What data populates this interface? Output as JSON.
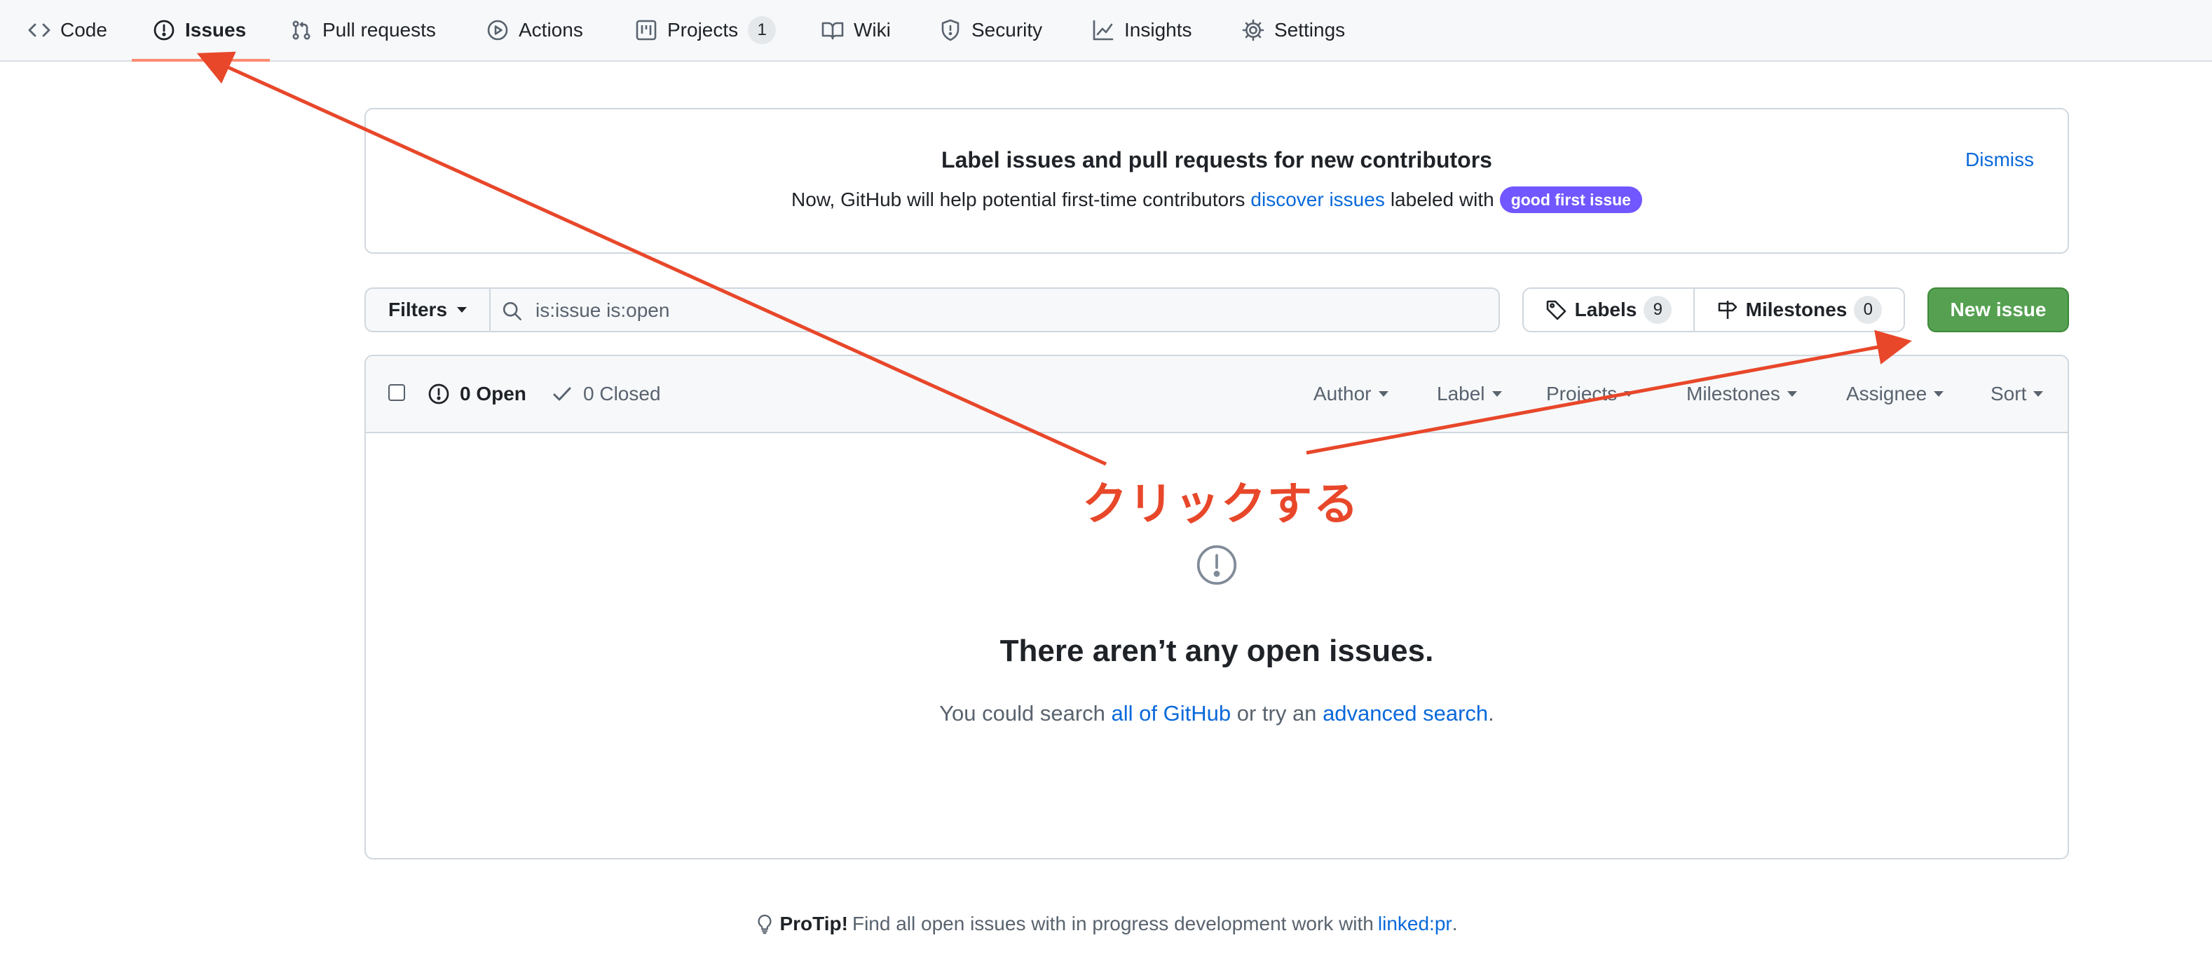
{
  "nav": {
    "code": "Code",
    "issues": "Issues",
    "pull_requests": "Pull requests",
    "actions": "Actions",
    "projects": "Projects",
    "projects_count": "1",
    "wiki": "Wiki",
    "security": "Security",
    "insights": "Insights",
    "settings": "Settings"
  },
  "banner": {
    "title": "Label issues and pull requests for new contributors",
    "text_before": "Now, GitHub will help potential first-time contributors",
    "link": "discover issues",
    "text_after": "labeled with",
    "label": "good first issue",
    "dismiss": "Dismiss"
  },
  "filters": {
    "button": "Filters",
    "search_value": "is:issue is:open",
    "labels": "Labels",
    "labels_count": "9",
    "milestones": "Milestones",
    "milestones_count": "0",
    "new_issue": "New issue"
  },
  "list_header": {
    "open": "0 Open",
    "closed": "0 Closed",
    "author": "Author",
    "label": "Label",
    "projects": "Projects",
    "milestones": "Milestones",
    "assignee": "Assignee",
    "sort": "Sort"
  },
  "blankslate": {
    "title": "There aren’t any open issues.",
    "text_1": "You could search",
    "link_1": "all of GitHub",
    "text_2": "or try an",
    "link_2": "advanced search",
    "text_3": "."
  },
  "protip": {
    "strong": "ProTip!",
    "text": "Find all open issues with in progress development work with",
    "link": "linked:pr",
    "end": "."
  },
  "annotation": {
    "text": "クリックする",
    "color": "#e8472a"
  },
  "colors": {
    "accent": "#0969da",
    "primary_button": "#55a051",
    "good_first_issue": "#7057ff",
    "selected_tab_underline": "#fd8c73"
  }
}
